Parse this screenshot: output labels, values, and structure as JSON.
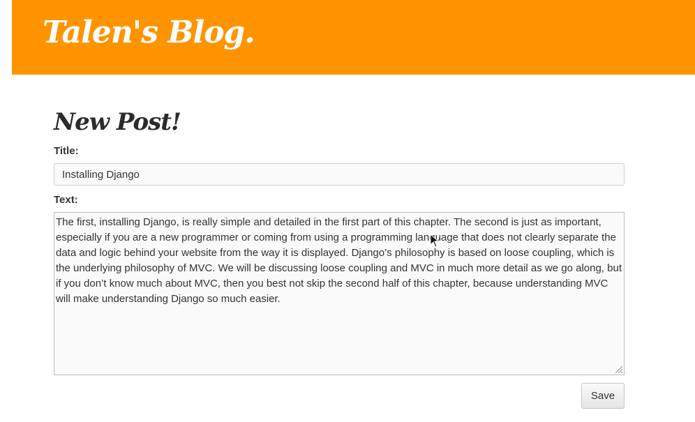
{
  "header": {
    "brand": "Talen's Blog."
  },
  "form": {
    "heading": "New Post!",
    "title_label": "Title:",
    "title_value": "Installing Django",
    "text_label": "Text:",
    "text_value": "The first, installing Django, is really simple and detailed in the first part of this chapter. The second is just as important, especially if you are a new programmer or coming from using a programming language that does not clearly separate the data and logic behind your website from the way it is displayed. Django’s philosophy is based on loose coupling, which is the underlying philosophy of MVC. We will be discussing loose coupling and MVC in much more detail as we go along, but if you don’t know much about MVC, then you best not skip the second half of this chapter, because understanding MVC will make understanding Django so much easier.",
    "save_label": "Save"
  },
  "colors": {
    "header_bg": "#ff9400",
    "brand_text": "#ffffff"
  },
  "icons": {
    "cursor": "arrow-pointer-icon",
    "resize": "resize-handle-icon"
  }
}
